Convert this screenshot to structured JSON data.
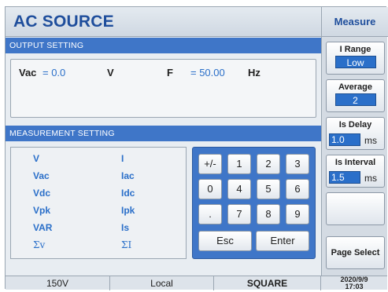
{
  "header": {
    "title": "AC SOURCE"
  },
  "sidebar": {
    "title": "Measure",
    "i_range": {
      "label": "I Range",
      "value": "Low"
    },
    "average": {
      "label": "Average",
      "value": "2"
    },
    "is_delay": {
      "label": "Is Delay",
      "value": "1.0",
      "unit": "ms"
    },
    "is_interval": {
      "label": "Is Interval",
      "value": "1.5",
      "unit": "ms"
    },
    "page_select": {
      "label": "Page Select"
    }
  },
  "output_setting": {
    "heading": "OUTPUT SETTING",
    "vac_label": "Vac",
    "vac_value": "= 0.0",
    "vac_unit": "V",
    "f_label": "F",
    "f_value": "= 50.00",
    "f_unit": "Hz"
  },
  "measurement_setting": {
    "heading": "MEASUREMENT SETTING",
    "left_items": [
      "V",
      "Vac",
      "Vdc",
      "Vpk",
      "VAR",
      "Σv"
    ],
    "right_items": [
      "I",
      "Iac",
      "Idc",
      "Ipk",
      "Is",
      "ΣI"
    ]
  },
  "keypad": {
    "keys": [
      "+/-",
      "1",
      "2",
      "3",
      "0",
      "4",
      "5",
      "6",
      ".",
      "7",
      "8",
      "9"
    ],
    "esc": "Esc",
    "enter": "Enter"
  },
  "statusbar": {
    "voltage_range": "150V",
    "mode": "Local",
    "waveform": "SQUARE",
    "date": "2020/9/9",
    "time": "17:03"
  }
}
